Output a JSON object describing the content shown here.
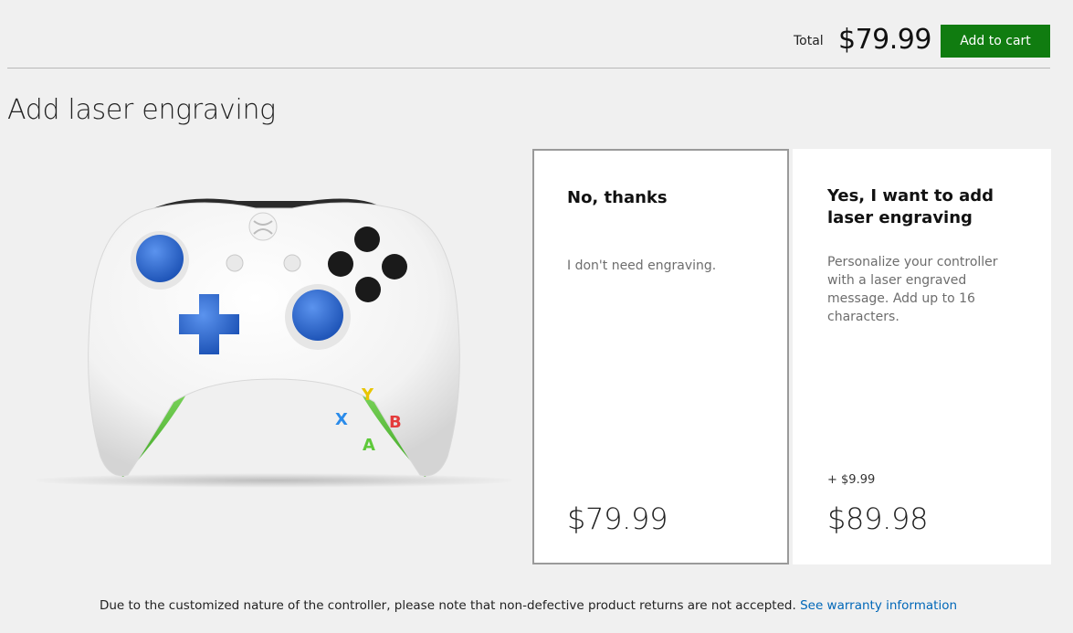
{
  "header": {
    "total_label": "Total",
    "total_price": "$79.99",
    "add_to_cart_label": "Add to cart"
  },
  "page": {
    "title": "Add laser engraving"
  },
  "product": {
    "image_alt": "Xbox wireless controller",
    "button_letters": [
      "Y",
      "X",
      "B",
      "A"
    ]
  },
  "options": [
    {
      "title": "No, thanks",
      "description": "I don't need engraving.",
      "addon": "",
      "price": "$79.99",
      "selected": true
    },
    {
      "title": "Yes, I want to add laser engraving",
      "description": "Personalize your controller with a laser engraved message. Add up to 16 characters.",
      "addon": "+ $9.99",
      "price": "$89.98",
      "selected": false
    }
  ],
  "footer": {
    "note": "Due to the customized nature of the controller, please note that non-defective product returns are not accepted.",
    "link_label": "See warranty information"
  },
  "colors": {
    "accent_green": "#107c10",
    "link_blue": "#0067b8",
    "controller_blue": "#2e6fd6",
    "controller_green": "#5ec93a",
    "background": "#f0f0f0"
  }
}
